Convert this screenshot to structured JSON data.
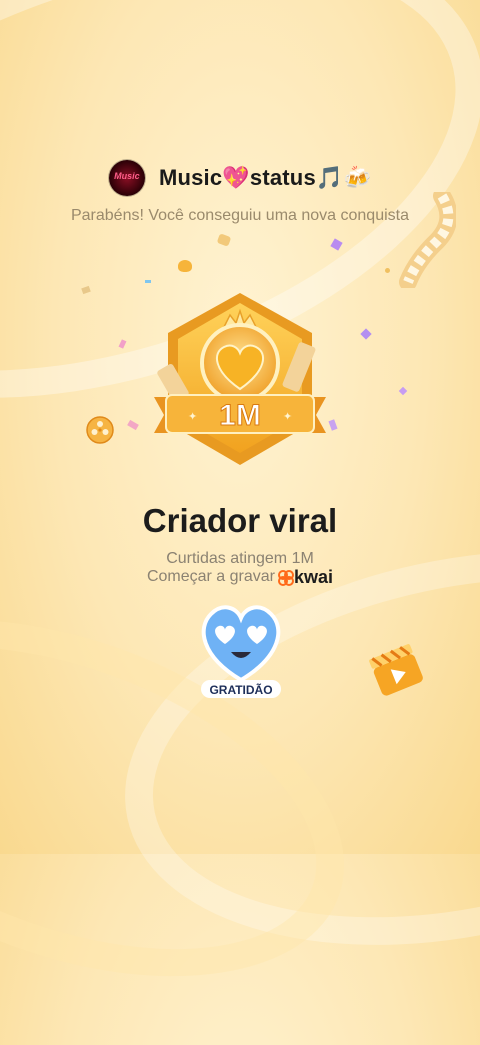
{
  "header": {
    "avatar_text": "Music",
    "title": "Music💖status🎵🍻"
  },
  "subtitle": "Parabéns! Você conseguiu uma nova conquista",
  "badge": {
    "value": "1M"
  },
  "achievement": {
    "title": "Criador viral",
    "line1": "Curtidas atingem 1M",
    "line2": "Começar a gravar",
    "brand": "kwai"
  },
  "sticker": {
    "label": "GRATIDÃO"
  },
  "colors": {
    "gold": "#f0a520",
    "orange": "#ff6a1a",
    "sticker_blue": "#6fb2f5"
  }
}
